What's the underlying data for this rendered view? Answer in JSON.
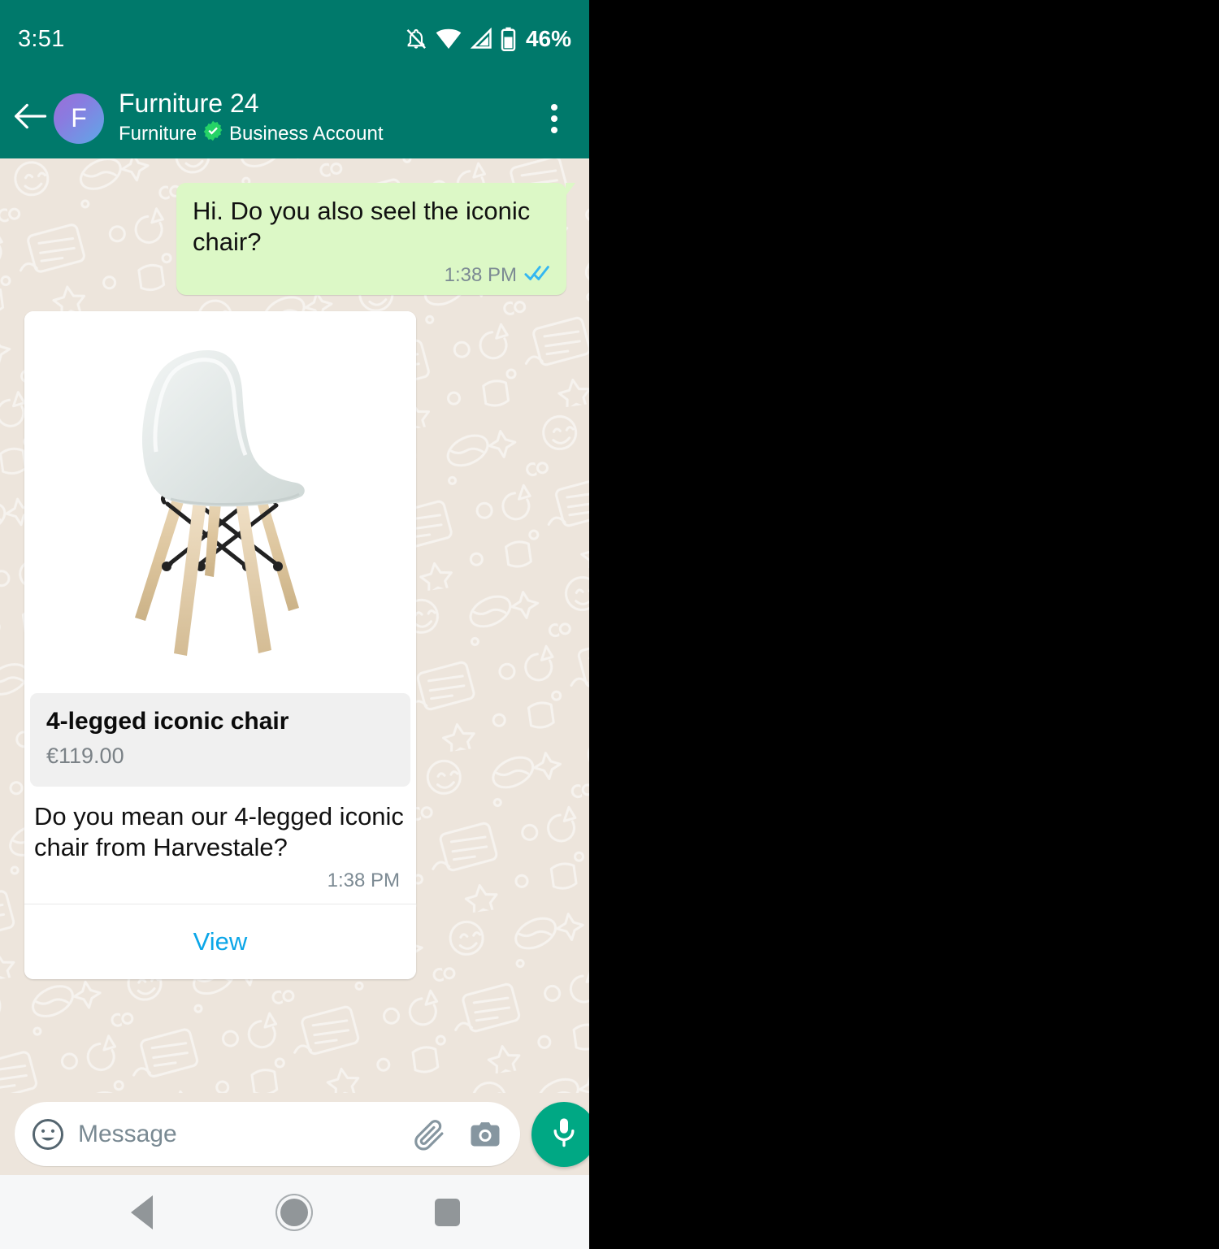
{
  "status_bar": {
    "clock": "3:51",
    "battery_percent": "46%",
    "icons": [
      "bell-off-icon",
      "wifi-icon",
      "signal-icon",
      "battery-icon"
    ]
  },
  "app_bar": {
    "back_icon": "arrow-left-icon",
    "avatar_letter": "F",
    "title": "Furniture 24",
    "subtitle_category": "Furniture",
    "verified_badge": "verified-business-icon",
    "subtitle_account": "Business Account",
    "overflow_icon": "more-vertical-icon"
  },
  "conversation": {
    "outgoing_message": {
      "text": "Hi. Do you also seel the iconic chair?",
      "time": "1:38 PM",
      "status_icon": "double-check-read-icon"
    },
    "product_card": {
      "image_alt": "4-legged iconic chair photo",
      "product_name": "4-legged iconic chair",
      "product_price": "€119.00",
      "message_text": "Do you mean our 4-legged iconic chair from Harvestale?",
      "time": "1:38 PM",
      "action_label": "View"
    }
  },
  "composer": {
    "emoji_icon": "emoji-smiley-icon",
    "placeholder": "Message",
    "value": "",
    "attach_icon": "paperclip-icon",
    "camera_icon": "camera-icon",
    "mic_icon": "microphone-icon"
  },
  "nav_bar": {
    "back_icon": "nav-back-triangle-icon",
    "home_icon": "nav-home-circle-icon",
    "recents_icon": "nav-recents-square-icon"
  },
  "colors": {
    "header_green": "#00796B",
    "chat_background": "#EDE5DC",
    "outgoing_bubble": "#DCF8C6",
    "mic_green": "#00A884",
    "view_link_blue": "#0BA6E8",
    "verified_green": "#25D366",
    "product_panel_grey": "#F0F0F0"
  }
}
